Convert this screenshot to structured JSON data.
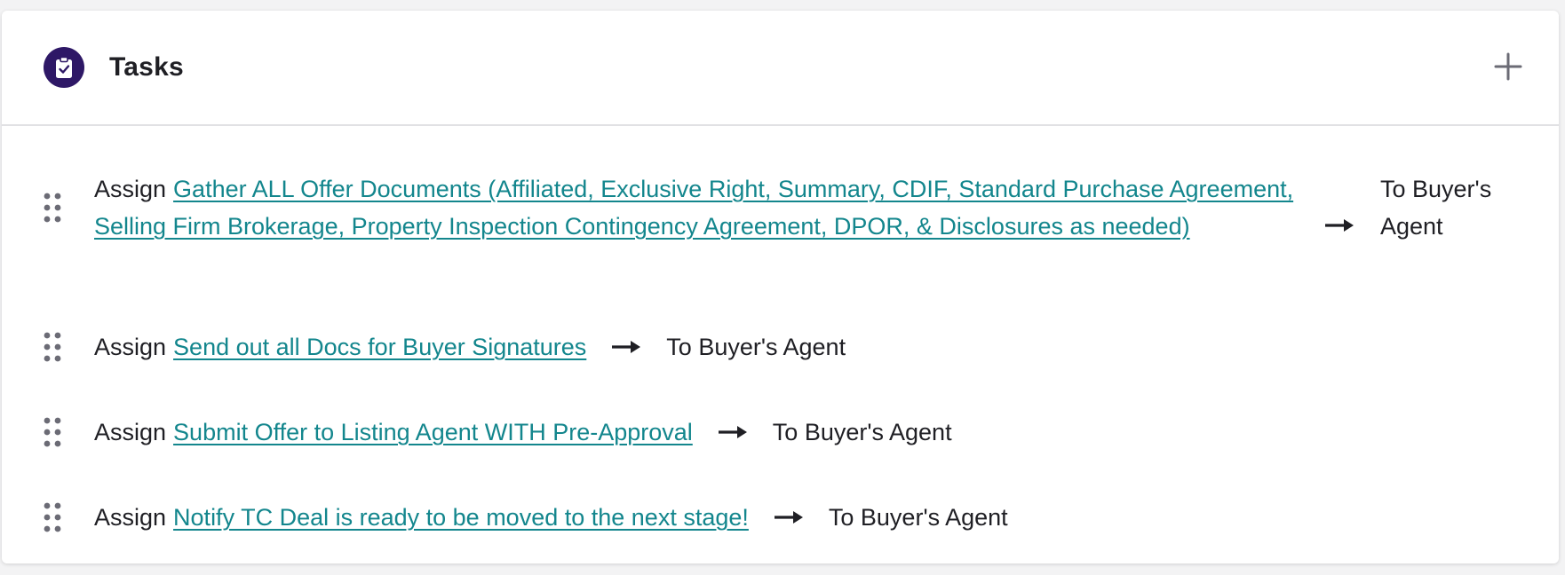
{
  "header": {
    "title": "Tasks",
    "icon": "clipboard-check-icon",
    "add_icon": "plus-icon",
    "icon_bg_color": "#2e1866"
  },
  "tasks": [
    {
      "prefix": "Assign",
      "link": "Gather ALL Offer Documents (Affiliated, Exclusive Right, Summary, CDIF, Standard Purchase Agreement, Selling Firm Brokerage, Property Inspection Contingency Agreement, DPOR, & Disclosures as needed)",
      "target": "To Buyer's Agent"
    },
    {
      "prefix": "Assign",
      "link": "Send out all Docs for Buyer Signatures",
      "target": "To Buyer's Agent"
    },
    {
      "prefix": "Assign",
      "link": "Submit Offer to Listing Agent WITH Pre-Approval",
      "target": "To Buyer's Agent"
    },
    {
      "prefix": "Assign",
      "link": "Notify TC Deal is ready to be moved to the next stage!",
      "target": "To Buyer's Agent"
    }
  ],
  "colors": {
    "link": "#13868d",
    "text": "#1f1f24",
    "grip": "#6b6b75"
  }
}
